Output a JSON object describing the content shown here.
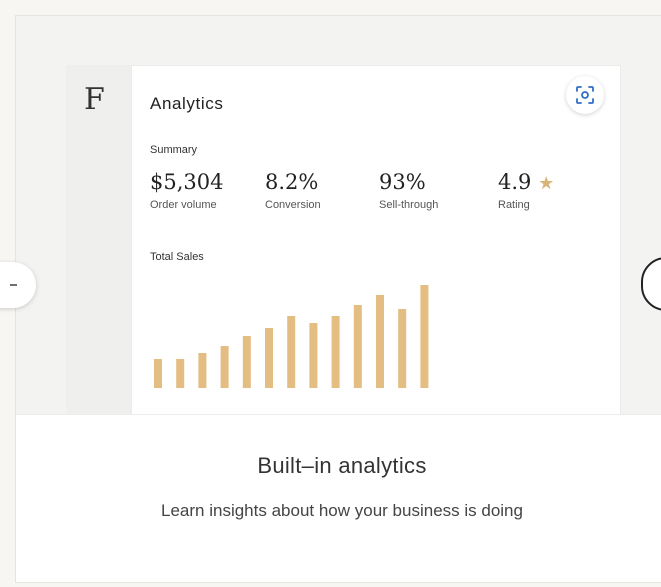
{
  "logo": {
    "letter": "F"
  },
  "panel": {
    "title": "Analytics",
    "zoom_icon": "scan-zoom-icon",
    "summary_label": "Summary",
    "metrics": [
      {
        "value": "$5,304",
        "label": "Order volume"
      },
      {
        "value": "8.2%",
        "label": "Conversion"
      },
      {
        "value": "93%",
        "label": "Sell-through"
      },
      {
        "value": "4.9",
        "label": "Rating",
        "icon": "star-icon"
      }
    ]
  },
  "chart_data": {
    "type": "bar",
    "title": "Total Sales",
    "values": [
      29,
      29,
      35,
      42,
      52,
      60,
      72,
      65,
      72,
      83,
      93,
      79,
      103
    ],
    "bar_color": "#e3bd82",
    "ylim": [
      0,
      103
    ]
  },
  "footer": {
    "title": "Built–in analytics",
    "description": "Learn insights about how your business is doing"
  },
  "nav": {
    "prev_icon": "chevron-left-icon",
    "next_icon": "chevron-right-icon"
  },
  "colors": {
    "accent": "#e3bd82",
    "star": "#d8b479",
    "zoom_icon": "#2f6ec7"
  }
}
